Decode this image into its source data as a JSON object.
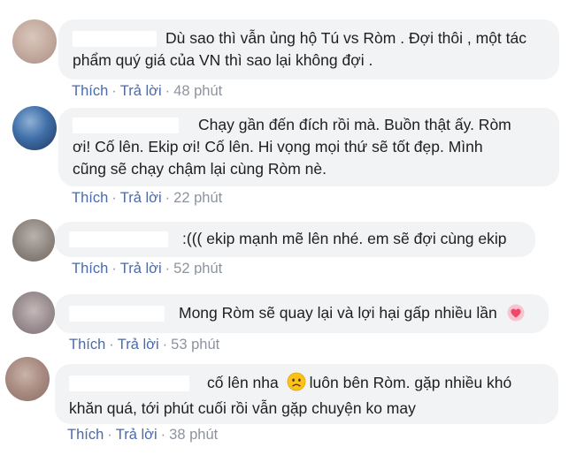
{
  "comments": [
    {
      "text_lines": [
        "Dù sao thì vẫn ủng hộ Tú vs Ròm . Đợi thôi , một tác",
        "phẩm quý giá của VN thì sao lại không đợi ."
      ],
      "like": "Thích",
      "reply": "Trả lời",
      "time": "48 phút"
    },
    {
      "text_lines": [
        "Chạy gần đến đích rồi mà. Buồn thật ấy. Ròm",
        "ơi! Cố lên. Ekip ơi! Cố lên. Hi vọng mọi thứ sẽ tốt đẹp. Mình",
        "cũng sẽ chạy chậm lại cùng Ròm nè."
      ],
      "like": "Thích",
      "reply": "Trả lời",
      "time": "22 phút"
    },
    {
      "text_lines": [
        ":((( ekip mạnh mẽ lên nhé. em sẽ đợi cùng ekip"
      ],
      "like": "Thích",
      "reply": "Trả lời",
      "time": "52 phút"
    },
    {
      "text_lines": [
        "Mong Ròm sẽ quay lại và lợi hại gấp nhiều lần"
      ],
      "emoji_icon": "heart-emoji-icon",
      "like": "Thích",
      "reply": "Trả lời",
      "time": "53 phút"
    },
    {
      "text_lines": [
        "cố lên nha",
        "luôn bên Ròm. gặp nhiều khó",
        "khăn quá, tới phút cuối rồi vẫn gặp chuyện ko may"
      ],
      "emoji_icon": "worried-face-emoji-icon",
      "like": "Thích",
      "reply": "Trả lời",
      "time": "38 phút"
    }
  ],
  "colors": {
    "bubble": "#f2f3f5",
    "link": "#4b6aa8",
    "meta": "#8d949e",
    "text": "#1c1e21"
  }
}
